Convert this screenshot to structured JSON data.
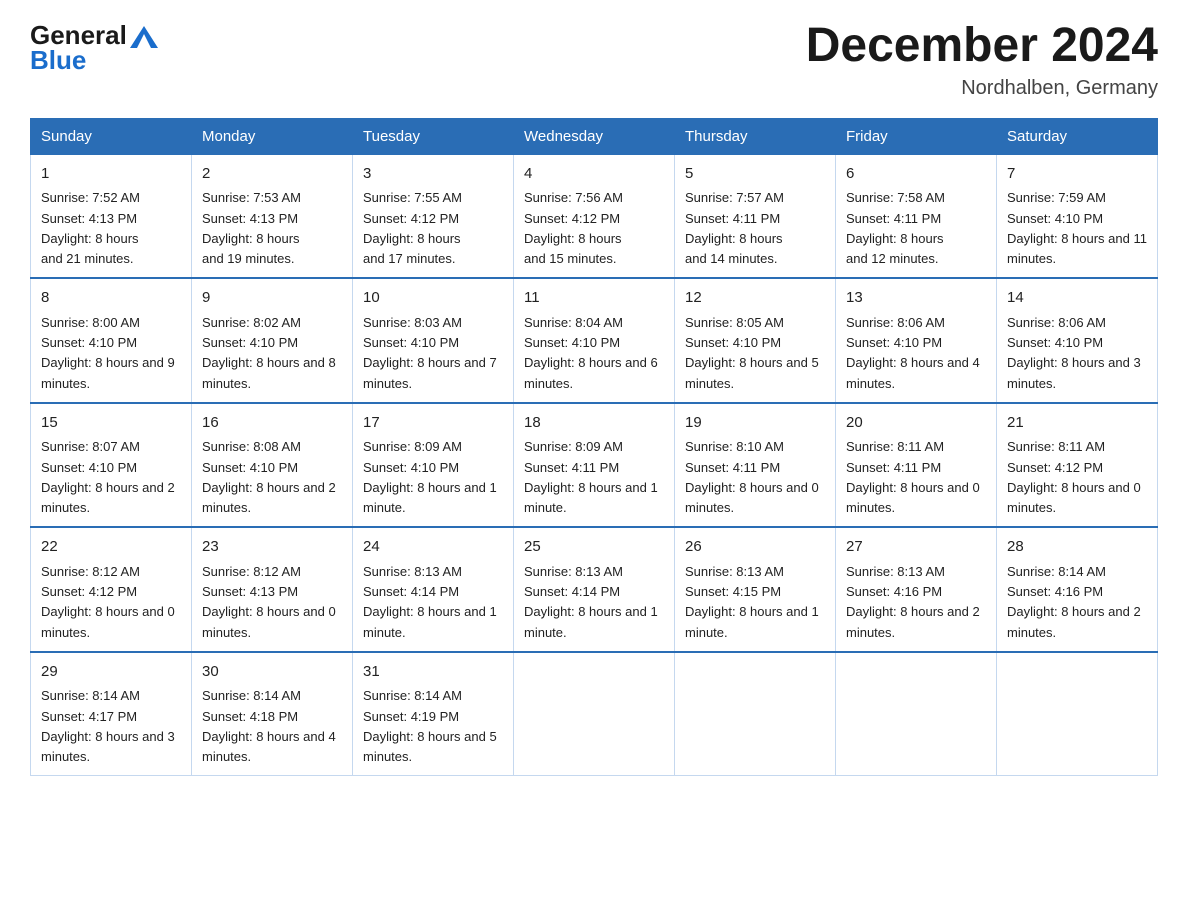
{
  "header": {
    "logo_general": "General",
    "logo_blue": "Blue",
    "title": "December 2024",
    "location": "Nordhalben, Germany"
  },
  "days_of_week": [
    "Sunday",
    "Monday",
    "Tuesday",
    "Wednesday",
    "Thursday",
    "Friday",
    "Saturday"
  ],
  "weeks": [
    [
      {
        "day": "1",
        "sunrise": "7:52 AM",
        "sunset": "4:13 PM",
        "daylight": "8 hours and 21 minutes."
      },
      {
        "day": "2",
        "sunrise": "7:53 AM",
        "sunset": "4:13 PM",
        "daylight": "8 hours and 19 minutes."
      },
      {
        "day": "3",
        "sunrise": "7:55 AM",
        "sunset": "4:12 PM",
        "daylight": "8 hours and 17 minutes."
      },
      {
        "day": "4",
        "sunrise": "7:56 AM",
        "sunset": "4:12 PM",
        "daylight": "8 hours and 15 minutes."
      },
      {
        "day": "5",
        "sunrise": "7:57 AM",
        "sunset": "4:11 PM",
        "daylight": "8 hours and 14 minutes."
      },
      {
        "day": "6",
        "sunrise": "7:58 AM",
        "sunset": "4:11 PM",
        "daylight": "8 hours and 12 minutes."
      },
      {
        "day": "7",
        "sunrise": "7:59 AM",
        "sunset": "4:10 PM",
        "daylight": "8 hours and 11 minutes."
      }
    ],
    [
      {
        "day": "8",
        "sunrise": "8:00 AM",
        "sunset": "4:10 PM",
        "daylight": "8 hours and 9 minutes."
      },
      {
        "day": "9",
        "sunrise": "8:02 AM",
        "sunset": "4:10 PM",
        "daylight": "8 hours and 8 minutes."
      },
      {
        "day": "10",
        "sunrise": "8:03 AM",
        "sunset": "4:10 PM",
        "daylight": "8 hours and 7 minutes."
      },
      {
        "day": "11",
        "sunrise": "8:04 AM",
        "sunset": "4:10 PM",
        "daylight": "8 hours and 6 minutes."
      },
      {
        "day": "12",
        "sunrise": "8:05 AM",
        "sunset": "4:10 PM",
        "daylight": "8 hours and 5 minutes."
      },
      {
        "day": "13",
        "sunrise": "8:06 AM",
        "sunset": "4:10 PM",
        "daylight": "8 hours and 4 minutes."
      },
      {
        "day": "14",
        "sunrise": "8:06 AM",
        "sunset": "4:10 PM",
        "daylight": "8 hours and 3 minutes."
      }
    ],
    [
      {
        "day": "15",
        "sunrise": "8:07 AM",
        "sunset": "4:10 PM",
        "daylight": "8 hours and 2 minutes."
      },
      {
        "day": "16",
        "sunrise": "8:08 AM",
        "sunset": "4:10 PM",
        "daylight": "8 hours and 2 minutes."
      },
      {
        "day": "17",
        "sunrise": "8:09 AM",
        "sunset": "4:10 PM",
        "daylight": "8 hours and 1 minute."
      },
      {
        "day": "18",
        "sunrise": "8:09 AM",
        "sunset": "4:11 PM",
        "daylight": "8 hours and 1 minute."
      },
      {
        "day": "19",
        "sunrise": "8:10 AM",
        "sunset": "4:11 PM",
        "daylight": "8 hours and 0 minutes."
      },
      {
        "day": "20",
        "sunrise": "8:11 AM",
        "sunset": "4:11 PM",
        "daylight": "8 hours and 0 minutes."
      },
      {
        "day": "21",
        "sunrise": "8:11 AM",
        "sunset": "4:12 PM",
        "daylight": "8 hours and 0 minutes."
      }
    ],
    [
      {
        "day": "22",
        "sunrise": "8:12 AM",
        "sunset": "4:12 PM",
        "daylight": "8 hours and 0 minutes."
      },
      {
        "day": "23",
        "sunrise": "8:12 AM",
        "sunset": "4:13 PM",
        "daylight": "8 hours and 0 minutes."
      },
      {
        "day": "24",
        "sunrise": "8:13 AM",
        "sunset": "4:14 PM",
        "daylight": "8 hours and 1 minute."
      },
      {
        "day": "25",
        "sunrise": "8:13 AM",
        "sunset": "4:14 PM",
        "daylight": "8 hours and 1 minute."
      },
      {
        "day": "26",
        "sunrise": "8:13 AM",
        "sunset": "4:15 PM",
        "daylight": "8 hours and 1 minute."
      },
      {
        "day": "27",
        "sunrise": "8:13 AM",
        "sunset": "4:16 PM",
        "daylight": "8 hours and 2 minutes."
      },
      {
        "day": "28",
        "sunrise": "8:14 AM",
        "sunset": "4:16 PM",
        "daylight": "8 hours and 2 minutes."
      }
    ],
    [
      {
        "day": "29",
        "sunrise": "8:14 AM",
        "sunset": "4:17 PM",
        "daylight": "8 hours and 3 minutes."
      },
      {
        "day": "30",
        "sunrise": "8:14 AM",
        "sunset": "4:18 PM",
        "daylight": "8 hours and 4 minutes."
      },
      {
        "day": "31",
        "sunrise": "8:14 AM",
        "sunset": "4:19 PM",
        "daylight": "8 hours and 5 minutes."
      },
      null,
      null,
      null,
      null
    ]
  ],
  "labels": {
    "sunrise_prefix": "Sunrise: ",
    "sunset_prefix": "Sunset: ",
    "daylight_prefix": "Daylight: "
  }
}
